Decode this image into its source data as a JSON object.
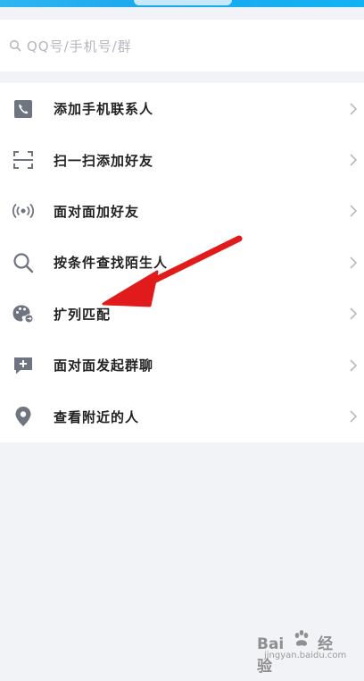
{
  "search": {
    "placeholder": "QQ号/手机号/群"
  },
  "menu": [
    {
      "label": "添加手机联系人",
      "icon": "phone-icon"
    },
    {
      "label": "扫一扫添加好友",
      "icon": "scan-icon"
    },
    {
      "label": "面对面加好友",
      "icon": "radar-signal-icon"
    },
    {
      "label": "按条件查找陌生人",
      "icon": "search-icon"
    },
    {
      "label": "扩列匹配",
      "icon": "match-palette-icon"
    },
    {
      "label": "面对面发起群聊",
      "icon": "add-chat-icon"
    },
    {
      "label": "查看附近的人",
      "icon": "location-pin-icon"
    }
  ],
  "watermark": {
    "main": "Bai",
    "suffix": "经验",
    "sub": "jingyan.baidu.com"
  },
  "colors": {
    "accent": "#12b3f2",
    "icon_gray": "#6f7580",
    "arrow_red": "#e11b1b"
  }
}
